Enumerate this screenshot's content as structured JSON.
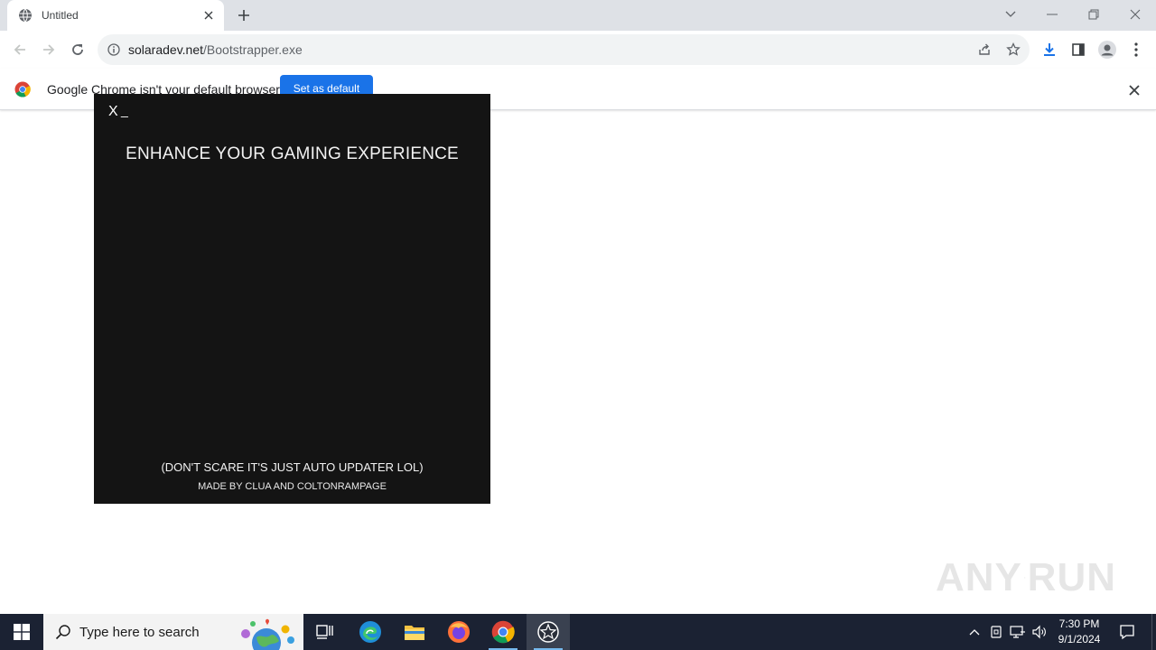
{
  "browser": {
    "tab": {
      "title": "Untitled"
    },
    "address": {
      "domain": "solaradev.net",
      "path": "/Bootstrapper.exe"
    }
  },
  "infobar": {
    "message": "Google Chrome isn't your default browser",
    "button_label": "Set as default"
  },
  "popup": {
    "close_label": "X",
    "minimize_label": "_",
    "headline": "ENHANCE YOUR GAMING EXPERIENCE",
    "note": "(DON'T SCARE IT'S JUST AUTO UPDATER LOL)",
    "credit": "MADE BY CLUA AND COLTONRAMPAGE"
  },
  "watermark": {
    "left": "ANY",
    "right": "RUN"
  },
  "taskbar": {
    "search_placeholder": "Type here to search",
    "apps": [
      "task-view",
      "edge",
      "file-explorer",
      "firefox",
      "chrome",
      "roblox-bootstrapper"
    ],
    "clock": {
      "time": "7:30 PM",
      "date": "9/1/2024"
    }
  },
  "colors": {
    "popup_bg": "#141414",
    "taskbar_bg": "#1b2233",
    "accent_blue": "#1a73e8",
    "tabstrip_bg": "#dee1e6"
  }
}
